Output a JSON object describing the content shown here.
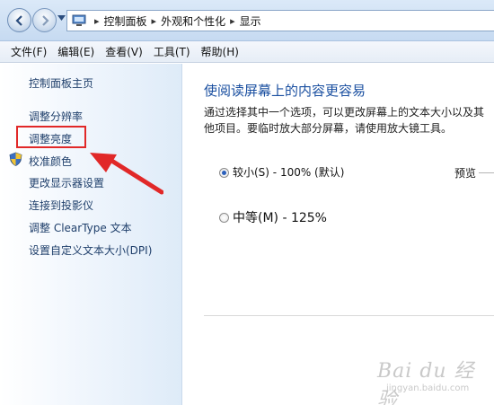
{
  "breadcrumb": {
    "items": [
      "控制面板",
      "外观和个性化",
      "显示"
    ],
    "separator": "▸"
  },
  "menu": [
    "文件(F)",
    "编辑(E)",
    "查看(V)",
    "工具(T)",
    "帮助(H)"
  ],
  "sidebar": {
    "home": "控制面板主页",
    "links": [
      "调整分辨率",
      "调整亮度",
      "校准颜色",
      "更改显示器设置",
      "连接到投影仪",
      "调整 ClearType 文本",
      "设置自定义文本大小(DPI)"
    ]
  },
  "main": {
    "title": "使阅读屏幕上的内容更容易",
    "description": "通过选择其中一个选项，可以更改屏幕上的文本大小以及其他项目。要临时放大部分屏幕，请使用放大镜工具。",
    "options": [
      {
        "label": "较小(S) - 100% (默认)",
        "checked": true
      },
      {
        "label": "中等(M) - 125%",
        "checked": false
      }
    ],
    "preview_label": "预览"
  },
  "watermark": {
    "main": "Bai du 经验",
    "sub": "jingyan.baidu.com"
  },
  "colors": {
    "link": "#1f3f6b",
    "title": "#1a4fa0",
    "highlight": "#e12828",
    "radio_dot": "#2a5fbb"
  }
}
